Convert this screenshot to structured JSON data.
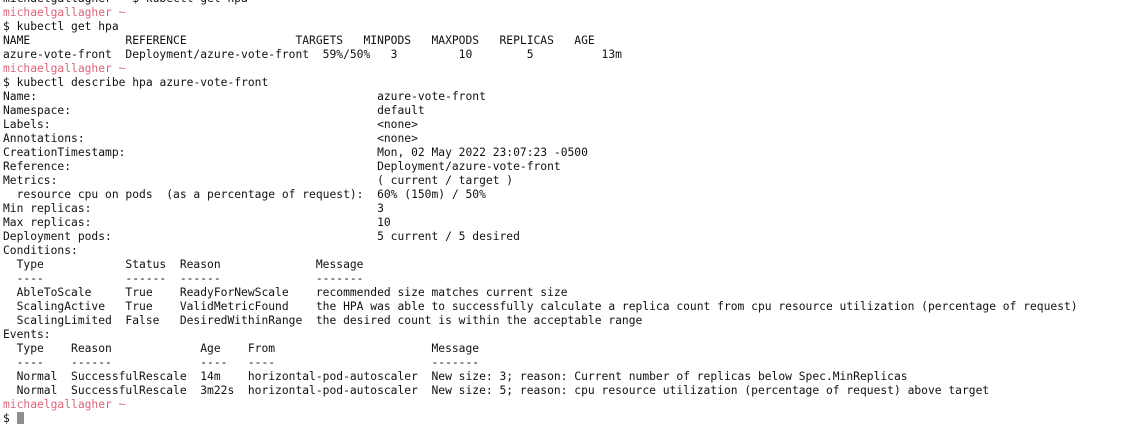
{
  "terminal": {
    "lines": [
      {
        "kind": "output",
        "text": "michaelgallagher ~ $ kubectl get hpa"
      },
      {
        "kind": "prompt",
        "user": "michaelgallagher ~"
      },
      {
        "kind": "command",
        "symbol": "$",
        "text": "kubectl get hpa"
      },
      {
        "kind": "output",
        "text": "NAME              REFERENCE                TARGETS   MINPODS   MAXPODS   REPLICAS   AGE"
      },
      {
        "kind": "output",
        "text": "azure-vote-front  Deployment/azure-vote-front  59%/50%   3         10        5          13m"
      },
      {
        "kind": "prompt",
        "user": "michaelgallagher ~"
      },
      {
        "kind": "command",
        "symbol": "$",
        "text": "kubectl describe hpa azure-vote-front"
      },
      {
        "kind": "output",
        "text": "Name:                                                  azure-vote-front"
      },
      {
        "kind": "output",
        "text": "Namespace:                                             default"
      },
      {
        "kind": "output",
        "text": "Labels:                                                <none>"
      },
      {
        "kind": "output",
        "text": "Annotations:                                           <none>"
      },
      {
        "kind": "output",
        "text": "CreationTimestamp:                                     Mon, 02 May 2022 23:07:23 -0500"
      },
      {
        "kind": "output",
        "text": "Reference:                                             Deployment/azure-vote-front"
      },
      {
        "kind": "output",
        "text": "Metrics:                                               ( current / target )"
      },
      {
        "kind": "output",
        "text": "  resource cpu on pods  (as a percentage of request):  60% (150m) / 50%"
      },
      {
        "kind": "output",
        "text": "Min replicas:                                          3"
      },
      {
        "kind": "output",
        "text": "Max replicas:                                          10"
      },
      {
        "kind": "output",
        "text": "Deployment pods:                                       5 current / 5 desired"
      },
      {
        "kind": "output",
        "text": "Conditions:"
      },
      {
        "kind": "output",
        "text": "  Type            Status  Reason              Message"
      },
      {
        "kind": "output",
        "text": "  ----            ------  ------              -------"
      },
      {
        "kind": "output",
        "text": "  AbleToScale     True    ReadyForNewScale    recommended size matches current size"
      },
      {
        "kind": "output",
        "text": "  ScalingActive   True    ValidMetricFound    the HPA was able to successfully calculate a replica count from cpu resource utilization (percentage of request)"
      },
      {
        "kind": "output",
        "text": "  ScalingLimited  False   DesiredWithinRange  the desired count is within the acceptable range"
      },
      {
        "kind": "output",
        "text": "Events:"
      },
      {
        "kind": "output",
        "text": "  Type    Reason             Age    From                       Message"
      },
      {
        "kind": "output",
        "text": "  ----    ------             ----   ----                       -------"
      },
      {
        "kind": "output",
        "text": "  Normal  SuccessfulRescale  14m    horizontal-pod-autoscaler  New size: 3; reason: Current number of replicas below Spec.MinReplicas"
      },
      {
        "kind": "output",
        "text": "  Normal  SuccessfulRescale  3m22s  horizontal-pod-autoscaler  New size: 5; reason: cpu resource utilization (percentage of request) above target"
      },
      {
        "kind": "prompt",
        "user": "michaelgallagher ~"
      },
      {
        "kind": "input",
        "symbol": "$",
        "text": ""
      }
    ]
  }
}
